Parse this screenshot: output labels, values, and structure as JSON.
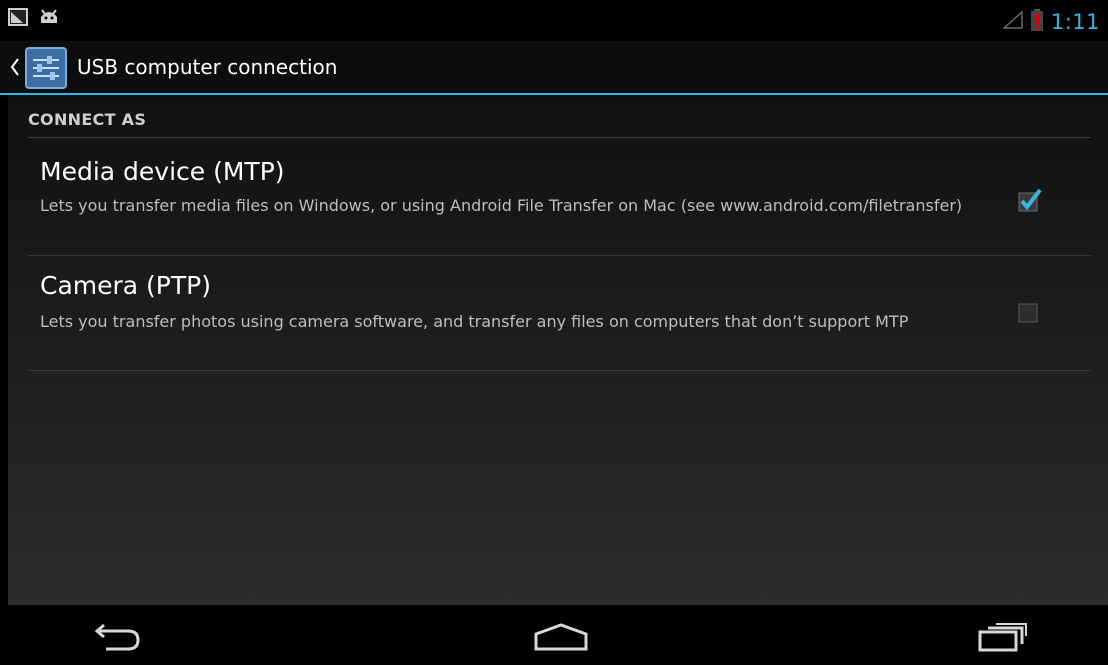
{
  "status_bar": {
    "time": "1:11",
    "icons": [
      "screenshot-notification-icon",
      "android-debug-icon",
      "signal-icon",
      "battery-low-icon"
    ],
    "colors": {
      "clock": "#33b5e5",
      "battery": "#cc0000"
    }
  },
  "action_bar": {
    "title": "USB computer connection",
    "icon": "settings-sliders-icon",
    "accent": "#33b5e5"
  },
  "section": {
    "header": "CONNECT AS"
  },
  "options": [
    {
      "title": "Media device (MTP)",
      "summary": "Lets you transfer media files on Windows, or using Android File Transfer on Mac (see www.android.com/filetransfer)",
      "checked": true
    },
    {
      "title": "Camera (PTP)",
      "summary": "Lets you transfer photos using camera software, and transfer any files on computers that don’t support MTP",
      "checked": false
    }
  ],
  "nav_bar": {
    "buttons": [
      "back-icon",
      "home-icon",
      "recents-icon"
    ]
  }
}
